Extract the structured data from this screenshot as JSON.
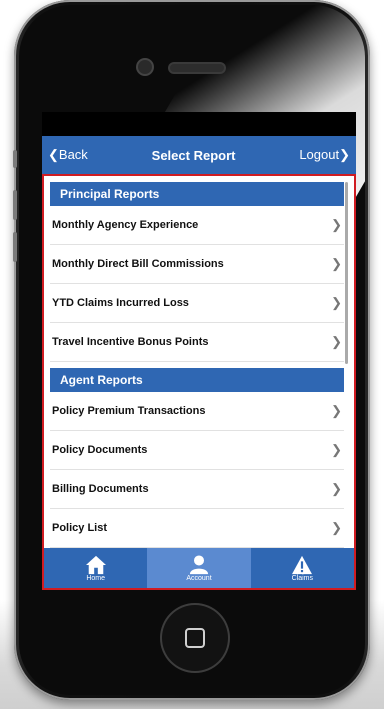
{
  "nav": {
    "back_label": "Back",
    "title": "Select Report",
    "logout_label": "Logout"
  },
  "sections": [
    {
      "title": "Principal Reports",
      "items": [
        {
          "label": "Monthly Agency Experience"
        },
        {
          "label": "Monthly Direct Bill Commissions"
        },
        {
          "label": "YTD Claims Incurred Loss"
        },
        {
          "label": "Travel Incentive Bonus Points"
        }
      ]
    },
    {
      "title": "Agent Reports",
      "items": [
        {
          "label": "Policy Premium Transactions"
        },
        {
          "label": "Policy Documents"
        },
        {
          "label": "Billing Documents"
        },
        {
          "label": "Policy List"
        }
      ]
    }
  ],
  "tabs": [
    {
      "label": "Home",
      "icon": "home-icon"
    },
    {
      "label": "Account",
      "icon": "person-icon"
    },
    {
      "label": "Claims",
      "icon": "warning-icon"
    }
  ],
  "colors": {
    "accent": "#2f67b3",
    "highlight_border": "#d01c22",
    "active_tab": "#5b8ad0"
  }
}
